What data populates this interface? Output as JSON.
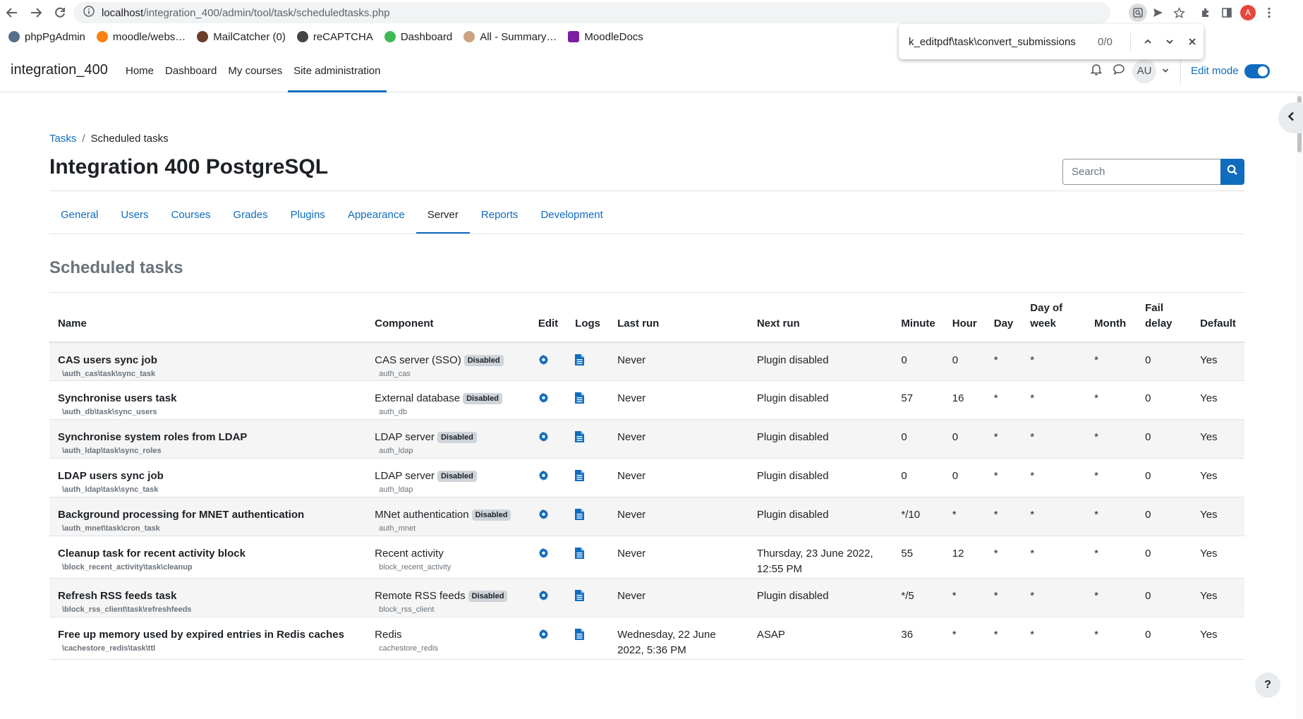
{
  "browser": {
    "url_host": "localhost",
    "url_path": "/integration_400/admin/tool/task/scheduledtasks.php",
    "profile_initial": "A",
    "bookmarks": [
      {
        "label": "phpPgAdmin",
        "icon": "elephant-icon",
        "color": "#5a6e8a"
      },
      {
        "label": "moodle/webs…",
        "icon": "moodle-icon",
        "color": "#f98012"
      },
      {
        "label": "MailCatcher (0)",
        "icon": "mail-icon",
        "color": "#6b3e26"
      },
      {
        "label": "reCAPTCHA",
        "icon": "globe-icon",
        "color": "#444444"
      },
      {
        "label": "Dashboard",
        "icon": "dashboard-icon",
        "color": "#3cba54"
      },
      {
        "label": "All - Summary…",
        "icon": "summary-icon",
        "color": "#c9a27e"
      },
      {
        "label": "MoodleDocs",
        "icon": "moodledocs-icon",
        "color": "#7b1fa2"
      }
    ],
    "find": {
      "query": "k_editpdf\\task\\convert_submissions",
      "count": "0/0"
    }
  },
  "navbar": {
    "brand": "integration_400",
    "items": [
      {
        "label": "Home",
        "active": false
      },
      {
        "label": "Dashboard",
        "active": false
      },
      {
        "label": "My courses",
        "active": false
      },
      {
        "label": "Site administration",
        "active": true
      }
    ],
    "avatar_initials": "AU",
    "edit_mode_label": "Edit mode",
    "edit_mode_on": true
  },
  "breadcrumb": {
    "link": "Tasks",
    "current": "Scheduled tasks"
  },
  "page_title": "Integration 400 PostgreSQL",
  "search": {
    "placeholder": "Search"
  },
  "tabs": [
    {
      "label": "General",
      "active": false
    },
    {
      "label": "Users",
      "active": false
    },
    {
      "label": "Courses",
      "active": false
    },
    {
      "label": "Grades",
      "active": false
    },
    {
      "label": "Plugins",
      "active": false
    },
    {
      "label": "Appearance",
      "active": false
    },
    {
      "label": "Server",
      "active": true
    },
    {
      "label": "Reports",
      "active": false
    },
    {
      "label": "Development",
      "active": false
    }
  ],
  "section_title": "Scheduled tasks",
  "table": {
    "headers": {
      "name": "Name",
      "component": "Component",
      "edit": "Edit",
      "logs": "Logs",
      "lastrun": "Last run",
      "nextrun": "Next run",
      "minute": "Minute",
      "hour": "Hour",
      "day": "Day",
      "dow_1": "Day of",
      "dow_2": "week",
      "month": "Month",
      "fail_1": "Fail",
      "fail_2": "delay",
      "default": "Default"
    },
    "disabled_badge": "Disabled",
    "rows": [
      {
        "name": "CAS users sync job",
        "class": "\\auth_cas\\task\\sync_task",
        "component": "CAS server (SSO)",
        "component_id": "auth_cas",
        "disabled": true,
        "lastrun": "Never",
        "nextrun": "Plugin disabled",
        "minute": "0",
        "hour": "0",
        "day": "*",
        "dow": "*",
        "month": "*",
        "fail": "0",
        "default": "Yes"
      },
      {
        "name": "Synchronise users task",
        "class": "\\auth_db\\task\\sync_users",
        "component": "External database",
        "component_id": "auth_db",
        "disabled": true,
        "lastrun": "Never",
        "nextrun": "Plugin disabled",
        "minute": "57",
        "hour": "16",
        "day": "*",
        "dow": "*",
        "month": "*",
        "fail": "0",
        "default": "Yes"
      },
      {
        "name": "Synchronise system roles from LDAP",
        "class": "\\auth_ldap\\task\\sync_roles",
        "component": "LDAP server",
        "component_id": "auth_ldap",
        "disabled": true,
        "lastrun": "Never",
        "nextrun": "Plugin disabled",
        "minute": "0",
        "hour": "0",
        "day": "*",
        "dow": "*",
        "month": "*",
        "fail": "0",
        "default": "Yes"
      },
      {
        "name": "LDAP users sync job",
        "class": "\\auth_ldap\\task\\sync_task",
        "component": "LDAP server",
        "component_id": "auth_ldap",
        "disabled": true,
        "lastrun": "Never",
        "nextrun": "Plugin disabled",
        "minute": "0",
        "hour": "0",
        "day": "*",
        "dow": "*",
        "month": "*",
        "fail": "0",
        "default": "Yes"
      },
      {
        "name": "Background processing for MNET authentication",
        "class": "\\auth_mnet\\task\\cron_task",
        "component": "MNet authentication",
        "component_id": "auth_mnet",
        "disabled": true,
        "lastrun": "Never",
        "nextrun": "Plugin disabled",
        "minute": "*/10",
        "hour": "*",
        "day": "*",
        "dow": "*",
        "month": "*",
        "fail": "0",
        "default": "Yes"
      },
      {
        "name": "Cleanup task for recent activity block",
        "class": "\\block_recent_activity\\task\\cleanup",
        "component": "Recent activity",
        "component_id": "block_recent_activity",
        "disabled": false,
        "lastrun": "Never",
        "nextrun": "Thursday, 23 June 2022, 12:55 PM",
        "minute": "55",
        "hour": "12",
        "day": "*",
        "dow": "*",
        "month": "*",
        "fail": "0",
        "default": "Yes"
      },
      {
        "name": "Refresh RSS feeds task",
        "class": "\\block_rss_client\\task\\refreshfeeds",
        "component": "Remote RSS feeds",
        "component_id": "block_rss_client",
        "disabled": true,
        "lastrun": "Never",
        "nextrun": "Plugin disabled",
        "minute": "*/5",
        "hour": "*",
        "day": "*",
        "dow": "*",
        "month": "*",
        "fail": "0",
        "default": "Yes"
      },
      {
        "name": "Free up memory used by expired entries in Redis caches",
        "class": "\\cachestore_redis\\task\\ttl",
        "component": "Redis",
        "component_id": "cachestore_redis",
        "disabled": false,
        "lastrun": "Wednesday, 22 June 2022, 5:36 PM",
        "nextrun": "ASAP",
        "minute": "36",
        "hour": "*",
        "day": "*",
        "dow": "*",
        "month": "*",
        "fail": "0",
        "default": "Yes"
      }
    ]
  },
  "help_label": "?"
}
